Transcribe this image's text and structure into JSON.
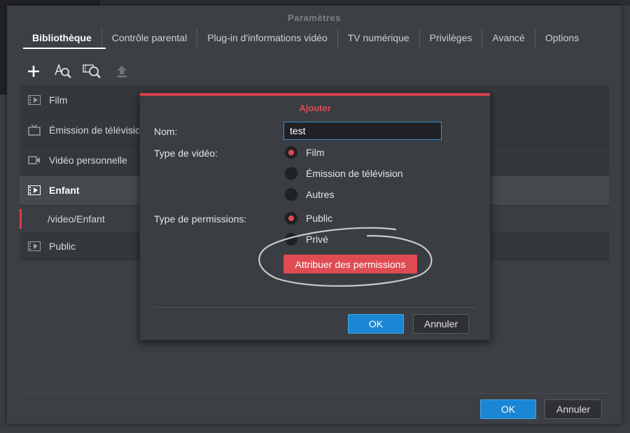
{
  "window": {
    "title": "Paramètres",
    "tabs": [
      {
        "label": "Bibliothèque",
        "active": true
      },
      {
        "label": "Contrôle parental"
      },
      {
        "label": "Plug-in d'informations vidéo"
      },
      {
        "label": "TV numérique"
      },
      {
        "label": "Privilèges"
      },
      {
        "label": "Avancé"
      },
      {
        "label": "Options"
      }
    ],
    "toolbar": [
      "add-icon",
      "search-text-icon",
      "search-library-icon",
      "upload-icon"
    ],
    "library": {
      "items": [
        {
          "label": "Film",
          "icon": "film-icon"
        },
        {
          "label": "Émission de télévision",
          "icon": "tv-icon"
        },
        {
          "label": "Vidéo personnelle",
          "icon": "video-camera-icon"
        },
        {
          "label": "Enfant",
          "icon": "film-icon",
          "selected": true
        },
        {
          "label": "/video/Enfant",
          "sub": true
        },
        {
          "label": "Public",
          "icon": "film-icon"
        }
      ]
    },
    "ok_label": "OK",
    "cancel_label": "Annuler"
  },
  "dialog": {
    "title": "Ajouter",
    "name_label": "Nom:",
    "name_value": "test",
    "video_type_label": "Type de vidéo:",
    "video_types": [
      {
        "label": "Film",
        "selected": true
      },
      {
        "label": "Émission de télévision"
      },
      {
        "label": "Autres"
      }
    ],
    "permission_type_label": "Type de permissions:",
    "permission_types": [
      {
        "label": "Public",
        "selected": true
      },
      {
        "label": "Privé"
      }
    ],
    "assign_permissions_label": "Attribuer des permissions",
    "ok_label": "OK",
    "cancel_label": "Annuler"
  },
  "colors": {
    "accent": "#d7404a",
    "primary_button": "#1a86d4",
    "window_bg": "#3c3f43"
  }
}
